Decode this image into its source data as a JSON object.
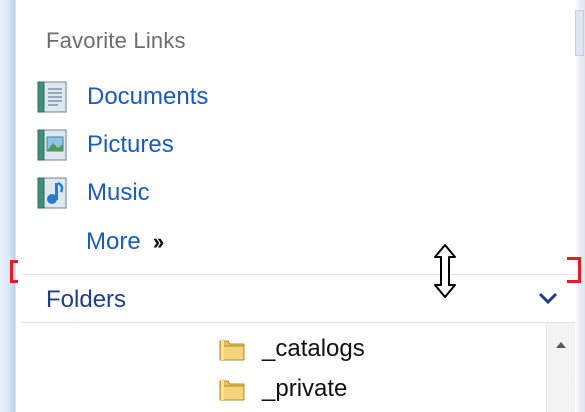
{
  "favorite_links": {
    "title": "Favorite Links",
    "items": [
      {
        "label": "Documents",
        "icon": "documents-icon"
      },
      {
        "label": "Pictures",
        "icon": "pictures-icon"
      },
      {
        "label": "Music",
        "icon": "music-icon"
      }
    ],
    "more_label": "More",
    "more_icon": "double-chevron-right-icon"
  },
  "folders": {
    "header_label": "Folders",
    "collapse_icon": "chevron-down-icon",
    "tree_items": [
      {
        "label": "_catalogs",
        "icon": "folder-icon"
      },
      {
        "label": "_private",
        "icon": "folder-icon"
      }
    ]
  },
  "cursor": "vertical-resize-cursor",
  "colors": {
    "link": "#1a5bbd",
    "folders_header": "#1f3d8a",
    "annotation": "#e02020"
  }
}
